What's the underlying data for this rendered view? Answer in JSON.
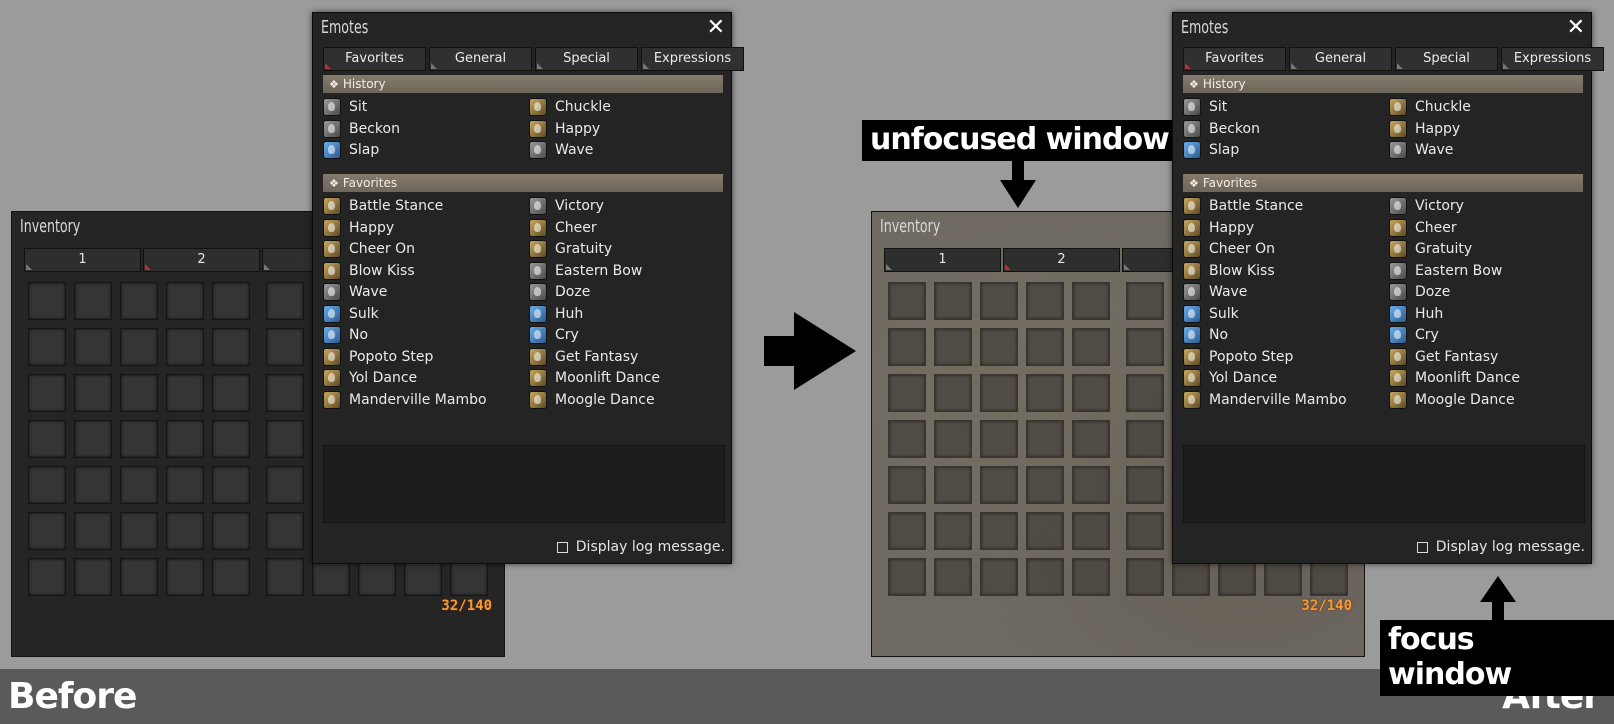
{
  "labels": {
    "before": "Before",
    "after": "After"
  },
  "annotations": {
    "unfocused": "unfocused window",
    "focus": "focus window"
  },
  "inventory": {
    "title": "Inventory",
    "tabs": [
      "1",
      "2"
    ],
    "count": "32/140"
  },
  "emotes": {
    "title": "Emotes",
    "close": "✕",
    "tabs": [
      "Favorites",
      "General",
      "Special",
      "Expressions"
    ],
    "history_label": "History",
    "favorites_label": "Favorites",
    "history": [
      {
        "name": "Sit",
        "icon": "gray"
      },
      {
        "name": "Chuckle",
        "icon": "gold"
      },
      {
        "name": "Beckon",
        "icon": "gray"
      },
      {
        "name": "Happy",
        "icon": "gold"
      },
      {
        "name": "Slap",
        "icon": "blue"
      },
      {
        "name": "Wave",
        "icon": "gray"
      }
    ],
    "favorites": [
      {
        "name": "Battle Stance",
        "icon": "gold"
      },
      {
        "name": "Victory",
        "icon": "gray"
      },
      {
        "name": "Happy",
        "icon": "gold"
      },
      {
        "name": "Cheer",
        "icon": "gold"
      },
      {
        "name": "Cheer On",
        "icon": "gold"
      },
      {
        "name": "Gratuity",
        "icon": "gold"
      },
      {
        "name": "Blow Kiss",
        "icon": "gold"
      },
      {
        "name": "Eastern Bow",
        "icon": "gray"
      },
      {
        "name": "Wave",
        "icon": "gray"
      },
      {
        "name": "Doze",
        "icon": "gray"
      },
      {
        "name": "Sulk",
        "icon": "blue"
      },
      {
        "name": "Huh",
        "icon": "blue"
      },
      {
        "name": "No",
        "icon": "blue"
      },
      {
        "name": "Cry",
        "icon": "blue"
      },
      {
        "name": "Popoto Step",
        "icon": "gold"
      },
      {
        "name": "Get Fantasy",
        "icon": "gold"
      },
      {
        "name": "Yol Dance",
        "icon": "gold"
      },
      {
        "name": "Moonlift Dance",
        "icon": "gold"
      },
      {
        "name": "Manderville Mambo",
        "icon": "gold"
      },
      {
        "name": "Moogle Dance",
        "icon": "gold"
      }
    ],
    "log_label": "Display log message."
  },
  "colors": {
    "background": "#9b9b9b",
    "footer": "#5a5a5a",
    "section_bar": "#847a6c",
    "count_text": "#f29a3a",
    "tab_marker": "#b3332b"
  }
}
